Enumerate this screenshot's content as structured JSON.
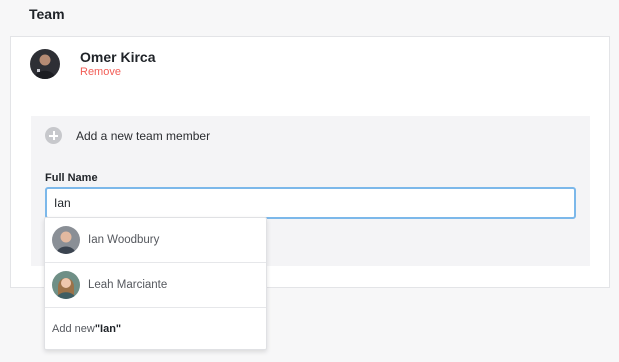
{
  "section": {
    "title": "Team"
  },
  "member": {
    "name": "Omer Kirca",
    "remove_label": "Remove"
  },
  "add_member": {
    "label": "Add a new team member"
  },
  "form": {
    "full_name_label": "Full Name",
    "full_name_value": "Ian"
  },
  "suggestions": [
    {
      "name": "Ian Woodbury",
      "avatar_icon": "avatar-ian-woodbury"
    },
    {
      "name": "Leah Marciante",
      "avatar_icon": "avatar-leah-marciante"
    }
  ],
  "add_new": {
    "prefix": "Add new ",
    "query": "\"Ian\""
  },
  "colors": {
    "accent_focus": "#7cb8ea",
    "remove": "#f25d56"
  }
}
